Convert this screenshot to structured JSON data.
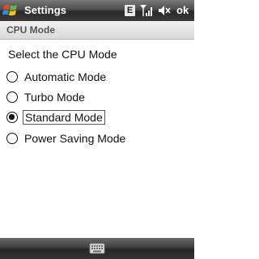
{
  "titlebar": {
    "title": "Settings",
    "data_indicator": "E",
    "ok_label": "ok"
  },
  "section": {
    "header": "CPU Mode"
  },
  "prompt": "Select the CPU Mode",
  "options": [
    {
      "label": "Automatic Mode",
      "selected": false
    },
    {
      "label": "Turbo Mode",
      "selected": false
    },
    {
      "label": "Standard Mode",
      "selected": true
    },
    {
      "label": "Power Saving Mode",
      "selected": false
    }
  ],
  "bottombar": {
    "keyboard_icon": "keyboard-icon"
  },
  "colors": {
    "bar_dark": "#2b2b2b",
    "header_text": "#555555",
    "text": "#111111"
  }
}
